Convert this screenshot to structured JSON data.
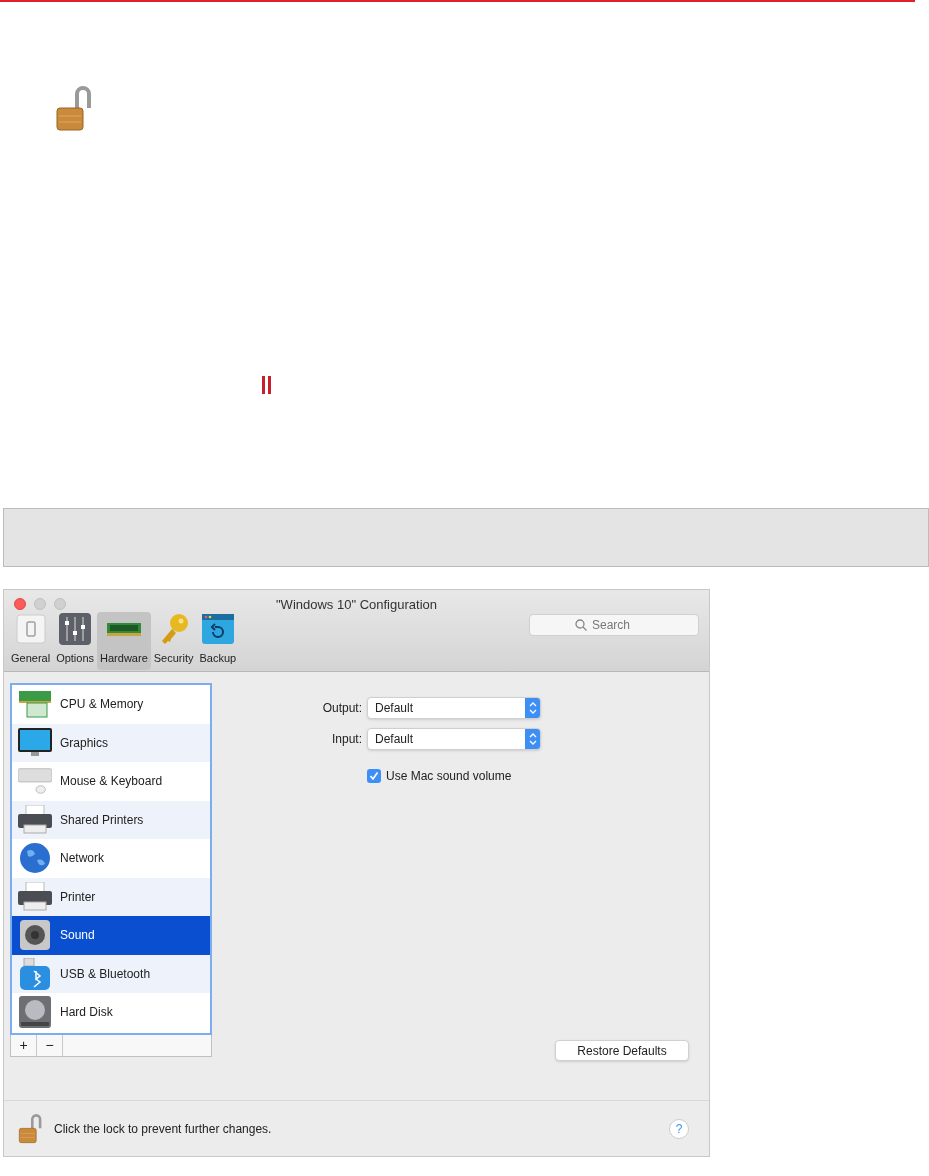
{
  "window": {
    "title": "\"Windows 10\" Configuration"
  },
  "toolbar": [
    {
      "label": "General",
      "kind": "general",
      "selected": false
    },
    {
      "label": "Options",
      "kind": "options",
      "selected": false
    },
    {
      "label": "Hardware",
      "kind": "hardware",
      "selected": true
    },
    {
      "label": "Security",
      "kind": "security",
      "selected": false
    },
    {
      "label": "Backup",
      "kind": "backup",
      "selected": false
    }
  ],
  "search": {
    "placeholder": "Search"
  },
  "sidebar": {
    "items": [
      {
        "label": "CPU & Memory",
        "kind": "cpu",
        "selected": false
      },
      {
        "label": "Graphics",
        "kind": "monitor",
        "selected": false
      },
      {
        "label": "Mouse & Keyboard",
        "kind": "keyboard",
        "selected": false
      },
      {
        "label": "Shared Printers",
        "kind": "printer",
        "selected": false
      },
      {
        "label": "Network",
        "kind": "globe",
        "selected": false
      },
      {
        "label": "Printer",
        "kind": "printer",
        "selected": false
      },
      {
        "label": "Sound",
        "kind": "speaker",
        "selected": true
      },
      {
        "label": "USB & Bluetooth",
        "kind": "usb",
        "selected": false
      },
      {
        "label": "Hard Disk",
        "kind": "disk",
        "selected": false
      }
    ],
    "add": "+",
    "remove": "−"
  },
  "fields": [
    {
      "label": "Output:",
      "value": "Default"
    },
    {
      "label": "Input:",
      "value": "Default"
    }
  ],
  "checkbox": {
    "label": "Use Mac sound volume",
    "checked": true
  },
  "restore_button": "Restore Defaults",
  "footer": {
    "text": "Click the lock to prevent further changes.",
    "help": "?"
  }
}
